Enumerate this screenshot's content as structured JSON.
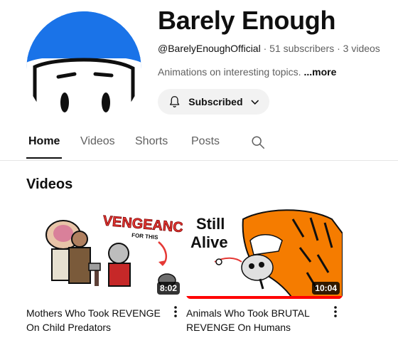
{
  "channel": {
    "name": "Barely Enough",
    "handle": "@BarelyEnoughOfficial",
    "subscribers": "51 subscribers",
    "videos_count": "3 videos",
    "separator": " · ",
    "description": "Animations on interesting topics. ",
    "more_label": "...more",
    "subscribe_label": "Subscribed",
    "avatar_color": "#1a73e8"
  },
  "tabs": [
    {
      "label": "Home",
      "active": true
    },
    {
      "label": "Videos"
    },
    {
      "label": "Shorts"
    },
    {
      "label": "Posts"
    }
  ],
  "section": {
    "title": "Videos"
  },
  "videos": [
    {
      "title": "Mothers Who Took REVENGE On Child Predators",
      "duration": "8:02",
      "thumb_text": "VENGEANCE",
      "thumb_subtext": "FOR THIS",
      "watched_fraction": 0
    },
    {
      "title": "Animals Who Took BRUTAL REVENGE On Humans",
      "duration": "10:04",
      "thumb_text_line1": "Still",
      "thumb_text_line2": "Alive",
      "watched_fraction": 1.0
    }
  ],
  "icons": {
    "bell": "bell-icon",
    "chevron": "chevron-down-icon",
    "search": "search-icon",
    "kebab": "more-vert-icon"
  }
}
